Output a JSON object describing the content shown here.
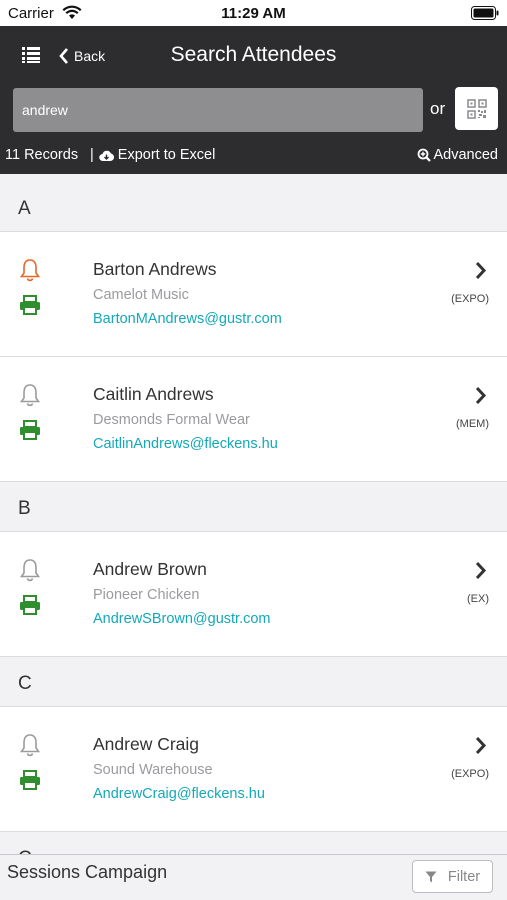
{
  "status_bar": {
    "carrier": "Carrier",
    "time": "11:29 AM"
  },
  "nav": {
    "back_label": "Back",
    "title": "Search Attendees"
  },
  "search": {
    "value": "andrew",
    "or_label": "or"
  },
  "records": {
    "count_label": "11 Records",
    "separator": "|",
    "export_label": "Export to Excel",
    "advanced_label": "Advanced"
  },
  "sections": [
    {
      "letter": "A",
      "attendees": [
        {
          "name": "Barton Andrews",
          "company": "Camelot Music",
          "email": "BartonMAndrews@gustr.com",
          "type": "(EXPO)",
          "alert": true
        },
        {
          "name": "Caitlin Andrews",
          "company": "Desmonds Formal Wear",
          "email": "CaitlinAndrews@fleckens.hu",
          "type": "(MEM)",
          "alert": false
        }
      ]
    },
    {
      "letter": "B",
      "attendees": [
        {
          "name": "Andrew Brown",
          "company": "Pioneer Chicken",
          "email": "AndrewSBrown@gustr.com",
          "type": "(EX)",
          "alert": false
        }
      ]
    },
    {
      "letter": "C",
      "attendees": [
        {
          "name": "Andrew Craig",
          "company": "Sound Warehouse",
          "email": "AndrewCraig@fleckens.hu",
          "type": "(EXPO)",
          "alert": false
        }
      ]
    },
    {
      "letter": "C",
      "attendees": []
    }
  ],
  "bottom": {
    "campaign_label": "Sessions Campaign",
    "filter_label": "Filter"
  },
  "colors": {
    "nav_bg": "#2d2d2f",
    "bell_alert": "#e8662a",
    "bell_default": "#9b9b9f",
    "printer": "#2f8f2f",
    "email": "#13a9b8"
  }
}
